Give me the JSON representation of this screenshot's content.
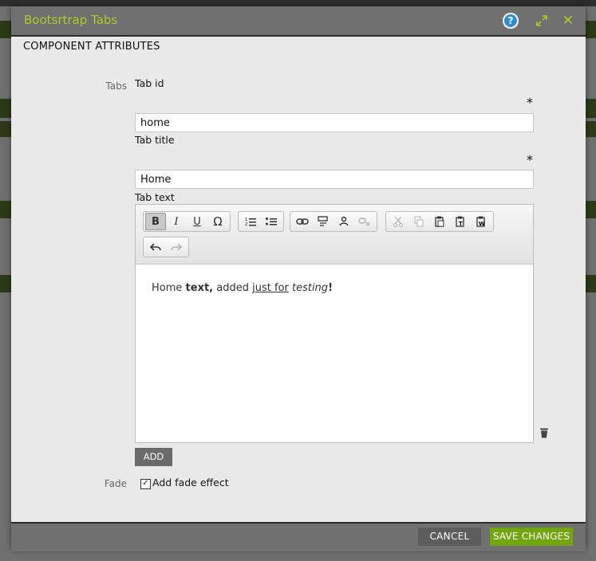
{
  "dialog": {
    "title": "Bootsrtrap Tabs",
    "accent_color": "#a8cc2a",
    "icons": [
      "help-icon",
      "expand-icon",
      "close-icon"
    ],
    "help_glyph": "?",
    "close_glyph": "✕"
  },
  "section": {
    "title": "COMPONENT ATTRIBUTES"
  },
  "tabs": {
    "group_label": "Tabs",
    "tab_id_label": "Tab id",
    "tab_id_value": "home",
    "tab_title_label": "Tab title",
    "tab_title_value": "Home",
    "tab_text_label": "Tab text",
    "required_marker": "*"
  },
  "editor": {
    "toolbar_buttons": [
      "bold",
      "italic",
      "underline",
      "special-character",
      "numbered-list",
      "bulleted-list",
      "link",
      "anchor",
      "unlink",
      "remove-link",
      "cut",
      "copy",
      "paste",
      "paste-text",
      "paste-word",
      "undo",
      "redo"
    ],
    "bold_glyph": "B",
    "italic_glyph": "I",
    "underline_glyph": "U",
    "special_char_glyph": "Ω",
    "content": {
      "p1": "Home ",
      "p2": "text,",
      "p3": " added ",
      "p4": "just for",
      "p5": " ",
      "p6": "testing",
      "p7": "!"
    }
  },
  "add_button": "ADD",
  "fade": {
    "label": "Fade",
    "checkbox_label": "Add fade effect",
    "checked": true,
    "check_glyph": "✓"
  },
  "footer": {
    "cancel": "CANCEL",
    "save": "SAVE CHANGES",
    "save_color": "#72a50f"
  }
}
